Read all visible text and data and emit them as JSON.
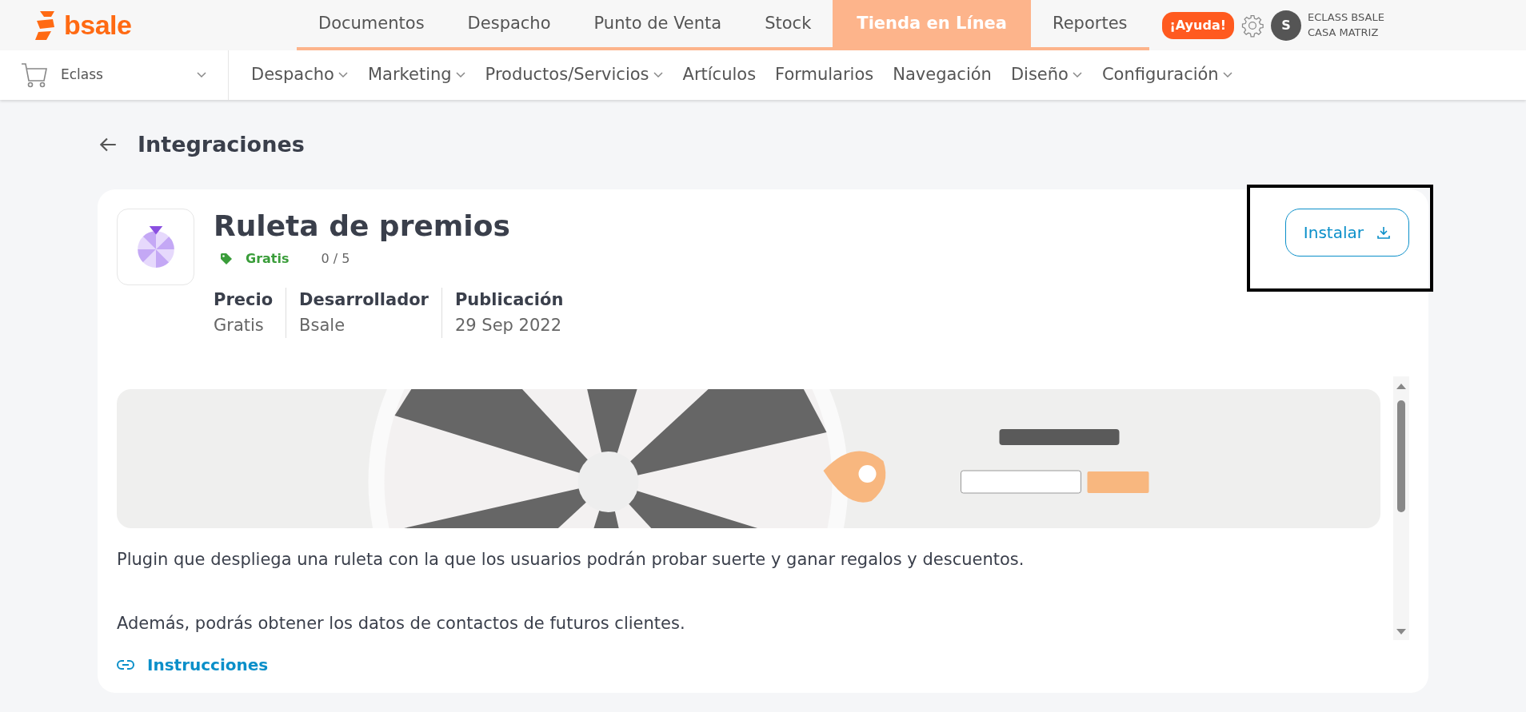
{
  "brand": {
    "name": "bsale"
  },
  "top_nav": [
    {
      "label": "Documentos",
      "selected": false
    },
    {
      "label": "Despacho",
      "selected": false
    },
    {
      "label": "Punto de Venta",
      "selected": false
    },
    {
      "label": "Stock",
      "selected": false
    },
    {
      "label": "Tienda en Línea",
      "selected": true
    },
    {
      "label": "Reportes",
      "selected": false
    }
  ],
  "help_button": "¡Ayuda!",
  "user": {
    "initial": "S",
    "name": "ECLASS BSALE",
    "branch": "CASA MATRIZ"
  },
  "store_selector": {
    "value": "Eclass"
  },
  "sub_nav": [
    {
      "label": "Despacho",
      "has_dropdown": true
    },
    {
      "label": "Marketing",
      "has_dropdown": true
    },
    {
      "label": "Productos/Servicios",
      "has_dropdown": true
    },
    {
      "label": "Artículos",
      "has_dropdown": false
    },
    {
      "label": "Formularios",
      "has_dropdown": false
    },
    {
      "label": "Navegación",
      "has_dropdown": false
    },
    {
      "label": "Diseño",
      "has_dropdown": true
    },
    {
      "label": "Configuración",
      "has_dropdown": true
    }
  ],
  "page": {
    "title": "Integraciones"
  },
  "app": {
    "name": "Ruleta de premios",
    "price_tag": "Gratis",
    "rating": "0 / 5",
    "meta": [
      {
        "label": "Precio",
        "value": "Gratis"
      },
      {
        "label": "Desarrollador",
        "value": "Bsale"
      },
      {
        "label": "Publicación",
        "value": "29 Sep 2022"
      }
    ],
    "install_button": {
      "label": "Instalar",
      "highlighted": true
    },
    "banner": {
      "kind": "picture"
    },
    "description": [
      "Plugin que despliega una ruleta con la que los usuarios podrán probar suerte y ganar regalos y descuentos.",
      "Además, podrás obtener los datos de contactos de futuros clientes."
    ],
    "link": "Instrucciones"
  }
}
